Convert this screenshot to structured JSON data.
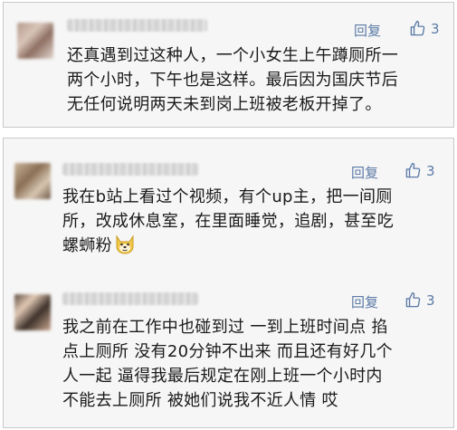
{
  "comments": [
    {
      "reply_label": "回复",
      "like_count": "3",
      "lines": [
        "还真遇到过这种人，一个小女生上午蹲厕所一",
        "两个小时，下午也是这样。最后因为国庆节后",
        "无任何说明两天未到岗上班被老板开掉了。"
      ]
    },
    {
      "reply_label": "回复",
      "like_count": "3",
      "lines": [
        "我在b站上看过个视频，有个up主，把一间厕",
        "所，改成休息室，在里面睡觉，追剧，甚至吃",
        "螺蛳粉"
      ],
      "emoji": "doge-emoji-icon"
    },
    {
      "reply_label": "回复",
      "like_count": "3",
      "lines": [
        "我之前在工作中也碰到过 一到上班时间点 掐",
        "点上厕所 没有20分钟不出来 而且还有好几个",
        "人一起 逼得我最后规定在刚上班一个小时内",
        "不能去上厕所 被她们说我不近人情 哎"
      ]
    }
  ],
  "colors": {
    "link": "#5b7aa6",
    "card_bg": "#f6f6f6",
    "card_border": "#c8c8c8",
    "text": "#1a1a1a"
  }
}
